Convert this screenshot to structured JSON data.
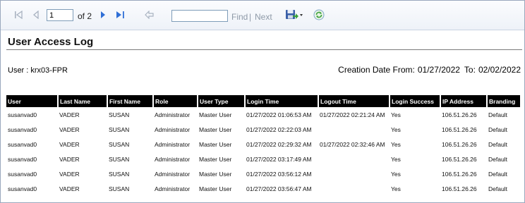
{
  "toolbar": {
    "page_value": "1",
    "of_text": "of 2",
    "find_label": "Find",
    "separator": "|",
    "next_label": "Next"
  },
  "report": {
    "title": "User Access Log",
    "user_line": "User : krx03-FPR",
    "creation_from_label": "Creation Date From:",
    "creation_from": "01/27/2022",
    "creation_to_label": "To:",
    "creation_to": "02/02/2022"
  },
  "table": {
    "headers": [
      "User",
      "Last Name",
      "First Name",
      "Role",
      "User Type",
      "Login Time",
      "Logout Time",
      "Login Success",
      "IP Address",
      "Branding"
    ],
    "rows": [
      [
        "susanvad0",
        "VADER",
        "SUSAN",
        "Administrator",
        "Master User",
        "01/27/2022 01:06:53 AM",
        "01/27/2022 02:21:24 AM",
        "Yes",
        "106.51.26.26",
        "Default"
      ],
      [
        "susanvad0",
        "VADER",
        "SUSAN",
        "Administrator",
        "Master User",
        "01/27/2022 02:22:03 AM",
        "",
        "Yes",
        "106.51.26.26",
        "Default"
      ],
      [
        "susanvad0",
        "VADER",
        "SUSAN",
        "Administrator",
        "Master User",
        "01/27/2022 02:29:32 AM",
        "01/27/2022 02:32:46 AM",
        "Yes",
        "106.51.26.26",
        "Default"
      ],
      [
        "susanvad0",
        "VADER",
        "SUSAN",
        "Administrator",
        "Master User",
        "01/27/2022 03:17:49 AM",
        "",
        "Yes",
        "106.51.26.26",
        "Default"
      ],
      [
        "susanvad0",
        "VADER",
        "SUSAN",
        "Administrator",
        "Master User",
        "01/27/2022 03:56:12 AM",
        "",
        "Yes",
        "106.51.26.26",
        "Default"
      ],
      [
        "susanvad0",
        "VADER",
        "SUSAN",
        "Administrator",
        "Master User",
        "01/27/2022 03:56:47 AM",
        "",
        "Yes",
        "106.51.26.26",
        "Default"
      ]
    ]
  },
  "icons": {
    "first_page": "first-page-icon",
    "prev_page": "previous-page-icon",
    "next_page": "next-page-icon",
    "last_page": "last-page-icon",
    "back": "back-to-parent-icon",
    "export": "export-save-icon",
    "refresh": "refresh-icon"
  },
  "colors": {
    "nav_active": "#2f6fd6",
    "nav_disabled": "#a9b3c1",
    "header_bg": "#000000",
    "refresh_green": "#3aa03a"
  }
}
